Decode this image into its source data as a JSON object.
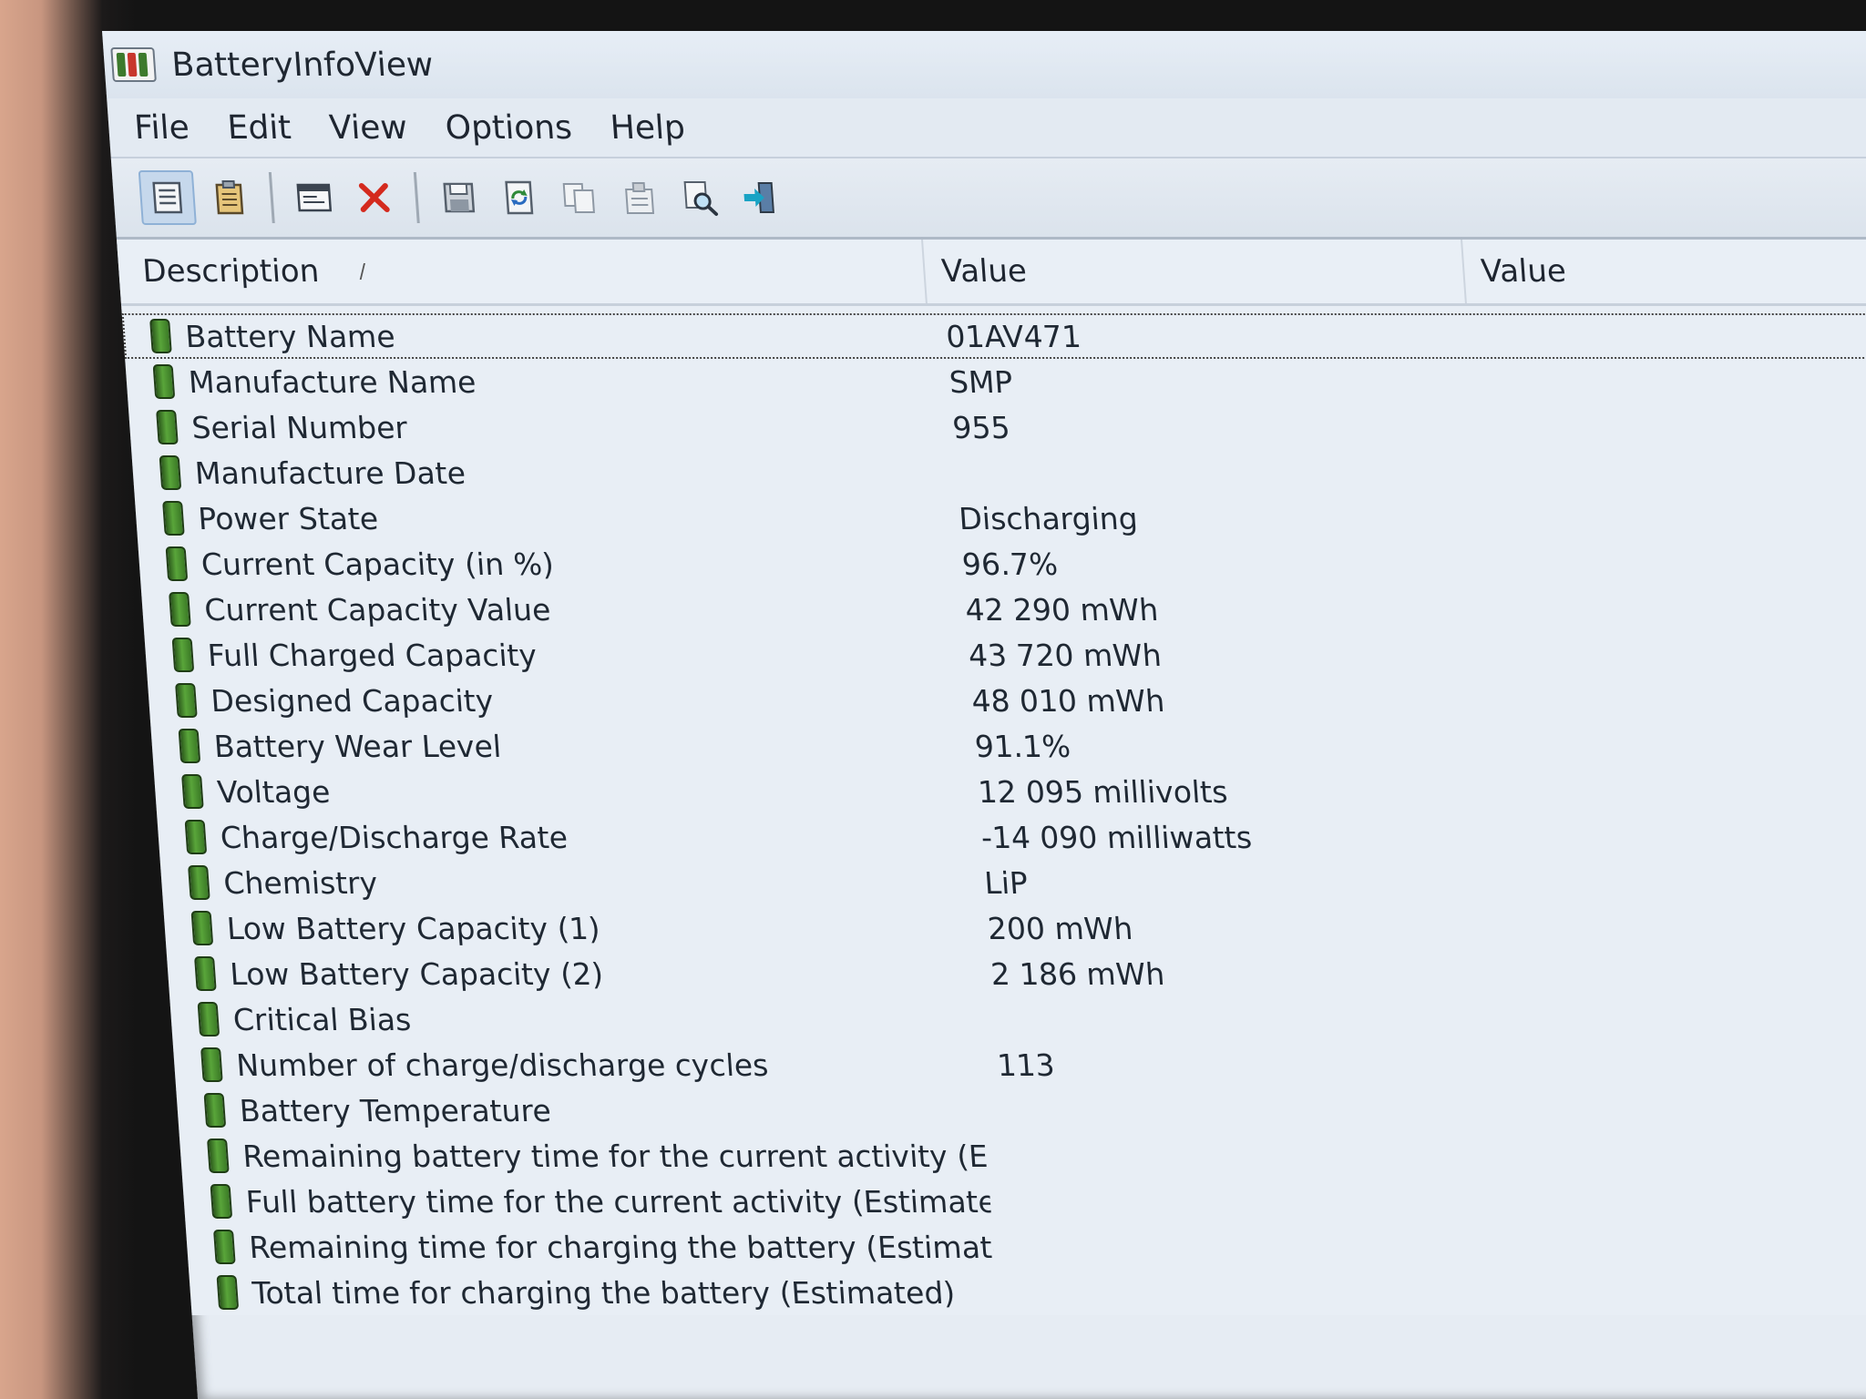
{
  "window": {
    "title": "BatteryInfoView"
  },
  "menu": [
    "File",
    "Edit",
    "View",
    "Options",
    "Help"
  ],
  "toolbar_icons": [
    "properties-icon",
    "clipboard-icon",
    "window-icon",
    "delete-icon",
    "save-icon",
    "refresh-icon",
    "copy-icon",
    "copy-properties-icon",
    "find-icon",
    "exit-icon"
  ],
  "columns": {
    "description": "Description",
    "sort_indicator": "/",
    "value1": "Value",
    "value2": "Value"
  },
  "rows": [
    {
      "desc": "Battery Name",
      "value": "01AV471"
    },
    {
      "desc": "Manufacture Name",
      "value": "SMP"
    },
    {
      "desc": "Serial Number",
      "value": "955"
    },
    {
      "desc": "Manufacture Date",
      "value": ""
    },
    {
      "desc": "Power State",
      "value": "Discharging"
    },
    {
      "desc": "Current Capacity (in %)",
      "value": "96.7%"
    },
    {
      "desc": "Current Capacity Value",
      "value": "42 290 mWh"
    },
    {
      "desc": "Full Charged Capacity",
      "value": "43 720 mWh"
    },
    {
      "desc": "Designed Capacity",
      "value": "48 010 mWh"
    },
    {
      "desc": "Battery Wear Level",
      "value": "91.1%"
    },
    {
      "desc": "Voltage",
      "value": "12 095 millivolts"
    },
    {
      "desc": "Charge/Discharge Rate",
      "value": "-14 090 milliwatts"
    },
    {
      "desc": "Chemistry",
      "value": "LiP"
    },
    {
      "desc": "Low Battery Capacity (1)",
      "value": "200 mWh"
    },
    {
      "desc": "Low Battery Capacity (2)",
      "value": "2 186 mWh"
    },
    {
      "desc": "Critical Bias",
      "value": ""
    },
    {
      "desc": "Number of charge/discharge cycles",
      "value": "113"
    },
    {
      "desc": "Battery Temperature",
      "value": ""
    },
    {
      "desc": "Remaining battery time for the current activity (Est...",
      "value": ""
    },
    {
      "desc": "Full battery time for the current activity (Estimated)",
      "value": ""
    },
    {
      "desc": "Remaining time for charging the battery (Estimated)",
      "value": ""
    },
    {
      "desc": "Total  time for charging the battery (Estimated)",
      "value": ""
    }
  ],
  "colors": {
    "battery_icon": "#3b7a26",
    "window_bg": "#e6ecf3"
  }
}
